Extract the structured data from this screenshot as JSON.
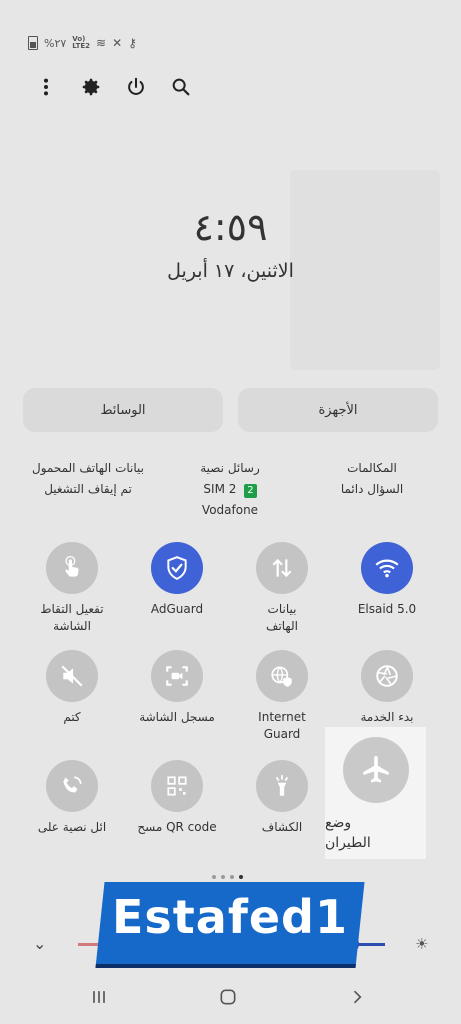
{
  "status": {
    "battery": "%٢٧",
    "volte": "Vo))\nLTE2"
  },
  "topbar": {
    "more": "more-options",
    "settings": "gear",
    "power": "power",
    "search": "search"
  },
  "clock": {
    "time": "٤:٥٩",
    "date": "الاثنين، ١٧ أبريل"
  },
  "tabs": {
    "media": "الوسائط",
    "devices": "الأجهزة"
  },
  "sim": {
    "mobile_data_title": "بيانات الهاتف المحمول",
    "mobile_data_value": "تم إيقاف التشغيل",
    "sms_title": "رسائل نصية",
    "sms_sim": "SIM 2",
    "sms_sim_badge": "2",
    "sms_carrier": "Vodafone",
    "calls_title": "المكالمات",
    "calls_value": "السؤال دائما"
  },
  "tiles": {
    "tap_capture": "تفعيل التقاط\nالشاشة",
    "adguard": "AdGuard",
    "mobile_data": "بيانات\nالهاتف",
    "wifi": "Elsaid 5.0",
    "mute": "كتم",
    "screen_recorder": "مسجل الشاشة",
    "internet_guard": "Internet\nGuard",
    "start_service": "بدء الخدمة",
    "sms_on": "ائل نصية على",
    "qr": "مسح QR code",
    "flashlight": "الكشاف",
    "airplane": "وضع\nالطيران"
  },
  "watermark": "Estafed1",
  "colors": {
    "accent": "#3f63d6",
    "highlight": "#f4f4f4",
    "background": "#e6e6e6"
  }
}
